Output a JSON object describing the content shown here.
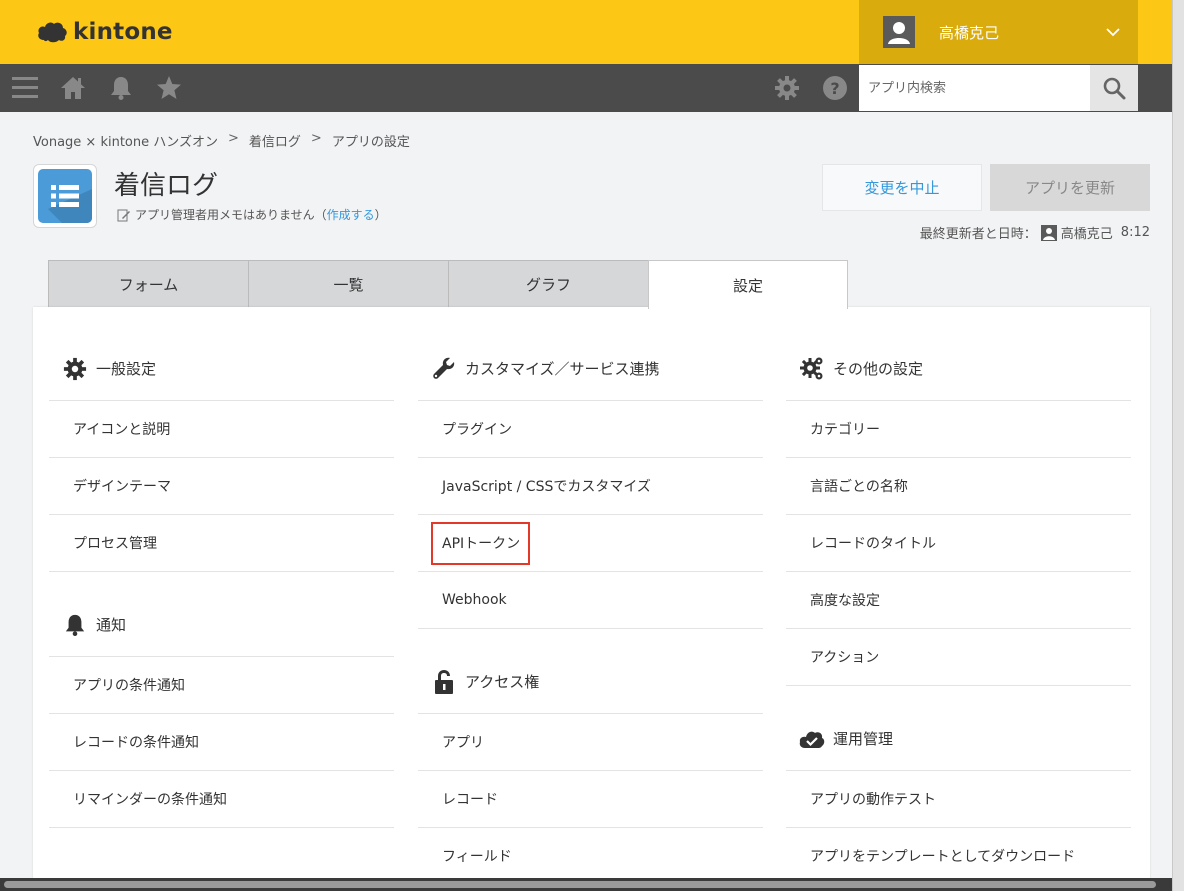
{
  "header": {
    "logo_text": "kintone",
    "user_name": "高橋克己"
  },
  "toolbar": {
    "search_placeholder": "アプリ内検索"
  },
  "breadcrumb": {
    "items": [
      "Vonage × kintone ハンズオン",
      "着信ログ",
      "アプリの設定"
    ],
    "separator": ">"
  },
  "app": {
    "title": "着信ログ",
    "memo_text": "アプリ管理者用メモはありません（",
    "memo_link": "作成する",
    "memo_close": "）"
  },
  "actions": {
    "cancel_label": "変更を中止",
    "update_label": "アプリを更新",
    "last_updated_label": "最終更新者と日時：",
    "last_updated_user": "高橋克己",
    "last_updated_time": "8:12"
  },
  "tabs": [
    {
      "label": "フォーム",
      "active": false
    },
    {
      "label": "一覧",
      "active": false
    },
    {
      "label": "グラフ",
      "active": false
    },
    {
      "label": "設定",
      "active": true
    }
  ],
  "settings": {
    "general": {
      "title": "一般設定",
      "items": [
        "アイコンと説明",
        "デザインテーマ",
        "プロセス管理"
      ]
    },
    "notification": {
      "title": "通知",
      "items": [
        "アプリの条件通知",
        "レコードの条件通知",
        "リマインダーの条件通知"
      ]
    },
    "customize": {
      "title": "カスタマイズ／サービス連携",
      "items": [
        "プラグイン",
        "JavaScript / CSSでカスタマイズ",
        "APIトークン",
        "Webhook"
      ]
    },
    "access": {
      "title": "アクセス権",
      "items": [
        "アプリ",
        "レコード",
        "フィールド"
      ]
    },
    "other": {
      "title": "その他の設定",
      "items": [
        "カテゴリー",
        "言語ごとの名称",
        "レコードのタイトル",
        "高度な設定",
        "アクション"
      ]
    },
    "operation": {
      "title": "運用管理",
      "items": [
        "アプリの動作テスト",
        "アプリをテンプレートとしてダウンロード"
      ]
    }
  },
  "colors": {
    "header_bg": "#fcc715",
    "user_area_bg": "#d9ab0c",
    "toolbar_bg": "#4b4b4b",
    "link": "#3498db",
    "highlight_box": "#e3392a"
  }
}
